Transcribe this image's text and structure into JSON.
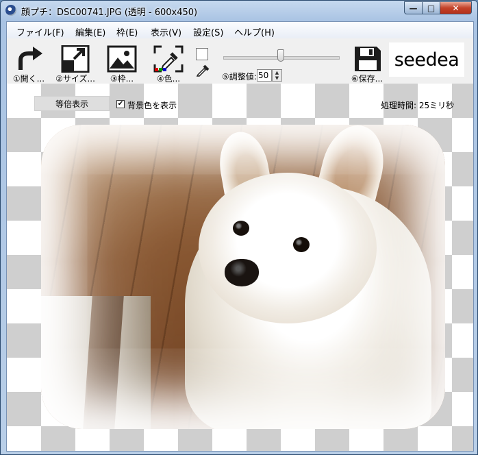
{
  "window": {
    "title": "顔プチ：DSC00741.JPG (透明 - 600x450)",
    "minimize": "—",
    "maximize": "□",
    "close": "✕"
  },
  "menu": [
    {
      "label": "ファイル(F)"
    },
    {
      "label": "編集(E)"
    },
    {
      "label": "枠(E)"
    },
    {
      "label": "表示(V)"
    },
    {
      "label": "設定(S)"
    },
    {
      "label": "ヘルプ(H)"
    }
  ],
  "toolbar": {
    "open": {
      "label": "①開く...",
      "icon": "redo-arrow-icon"
    },
    "size": {
      "label": "②サイズ...",
      "icon": "resize-icon"
    },
    "frame": {
      "label": "③枠...",
      "icon": "image-frame-icon"
    },
    "color": {
      "label": "④色...",
      "icon": "eyedropper-frame-icon"
    },
    "swatch_color": "#ffffff",
    "adjust_label": "⑤調整値:",
    "adjust_value": "50",
    "slider_value": 50,
    "save": {
      "label": "⑥保存...",
      "icon": "floppy-disk-icon"
    },
    "logo": "seedea"
  },
  "infobar": {
    "actual_size_button": "等倍表示",
    "show_background_checked": true,
    "show_background_label": "背景色を表示",
    "processing_time": "処理時間: 25ミリ秒"
  },
  "colors": {
    "checker_dark": "#cfcfcf",
    "checker_light": "#ffffff",
    "close_red": "#c4432a"
  }
}
